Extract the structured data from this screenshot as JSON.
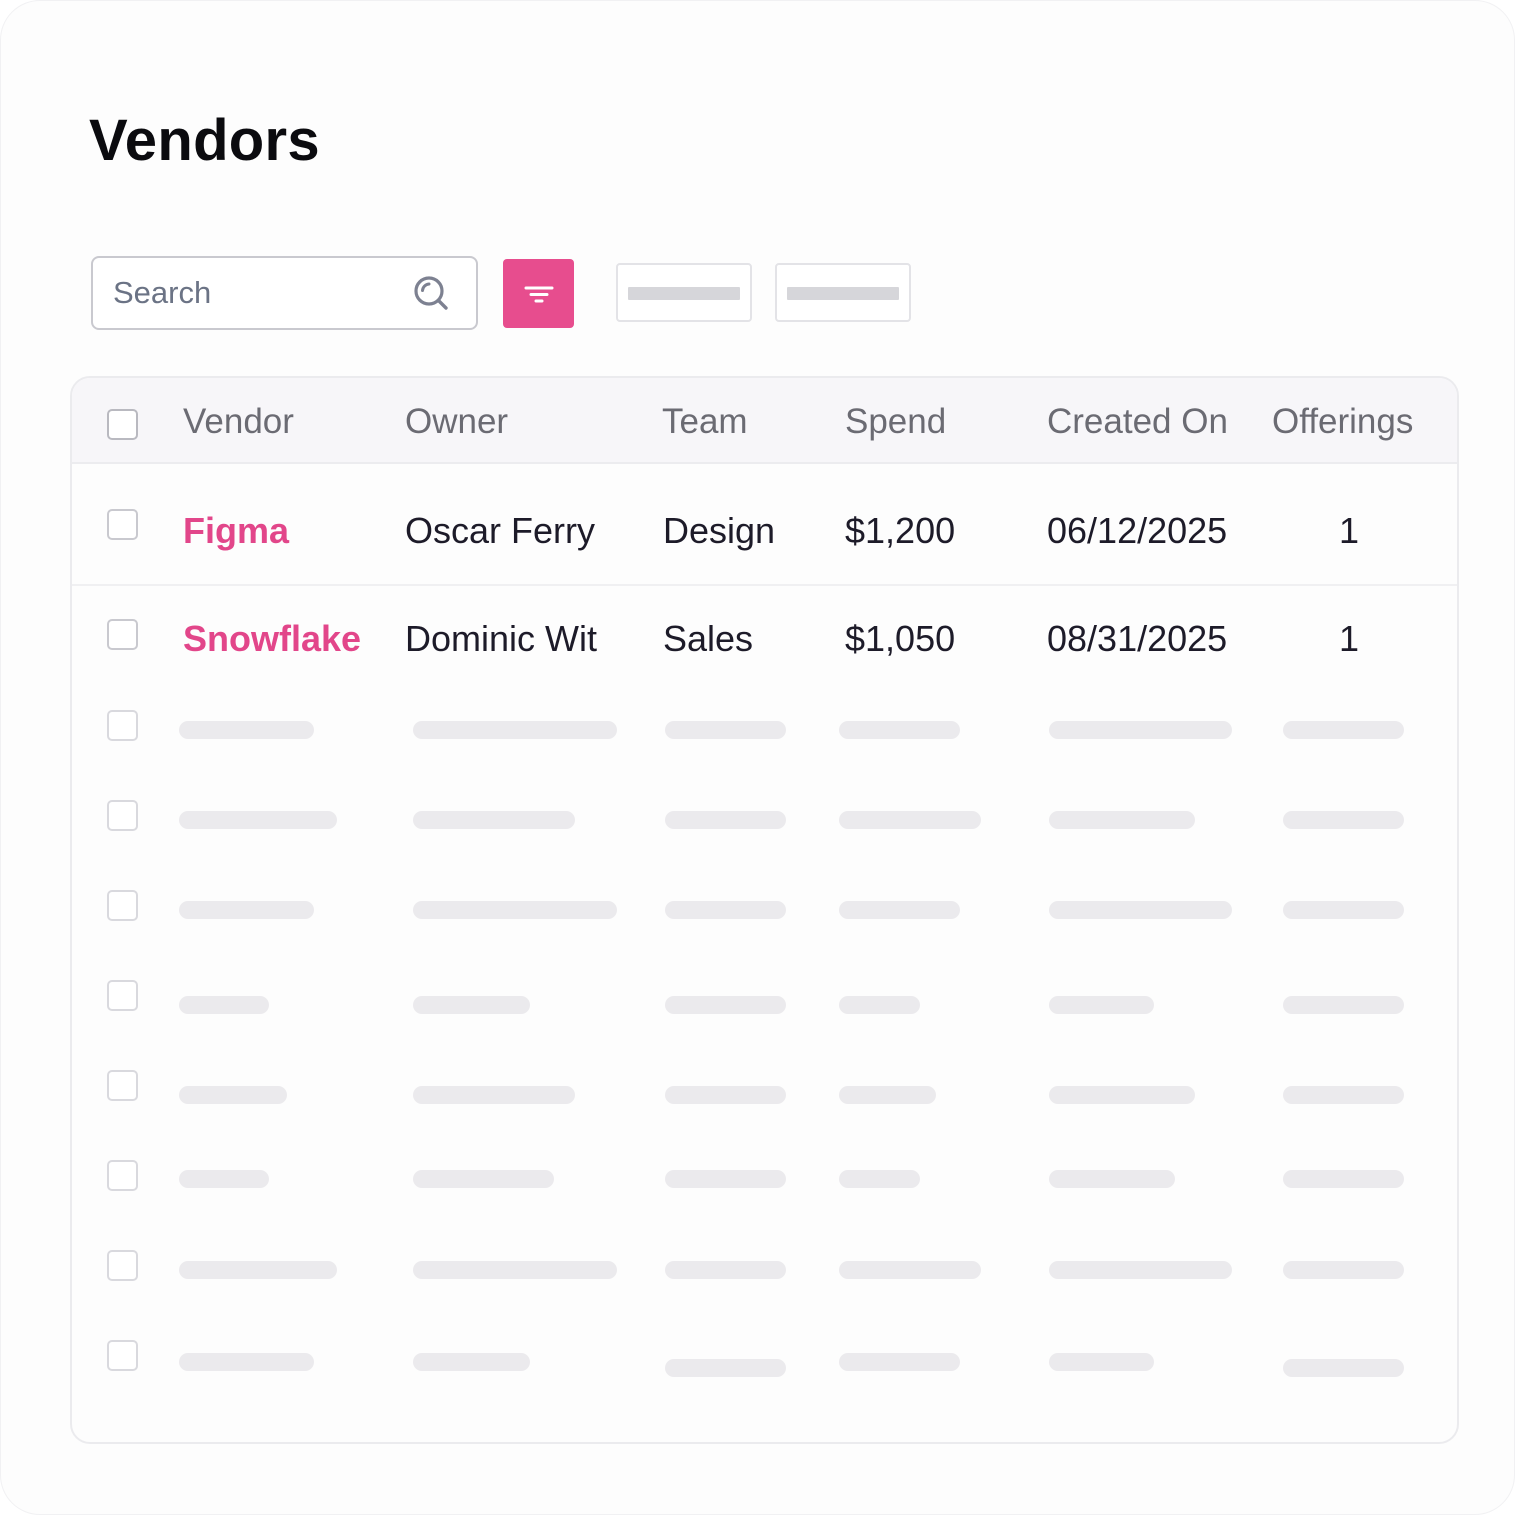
{
  "page": {
    "title": "Vendors"
  },
  "toolbar": {
    "search_placeholder": "Search",
    "accent_color": "#e74d8e",
    "search_icon": "search-icon",
    "filter_icon": "filter-icon"
  },
  "table": {
    "columns": [
      "Vendor",
      "Owner",
      "Team",
      "Spend",
      "Created On",
      "Offerings"
    ],
    "rows": [
      {
        "vendor": "Figma",
        "owner": "Oscar Ferry",
        "team": "Design",
        "spend": "$1,200",
        "created_on": "06/12/2025",
        "offerings": "1"
      },
      {
        "vendor": "Snowflake",
        "owner": "Dominic Wit",
        "team": "Sales",
        "spend": "$1,050",
        "created_on": "08/31/2025",
        "offerings": "1"
      }
    ],
    "vendor_link_color": "#e2468a"
  }
}
